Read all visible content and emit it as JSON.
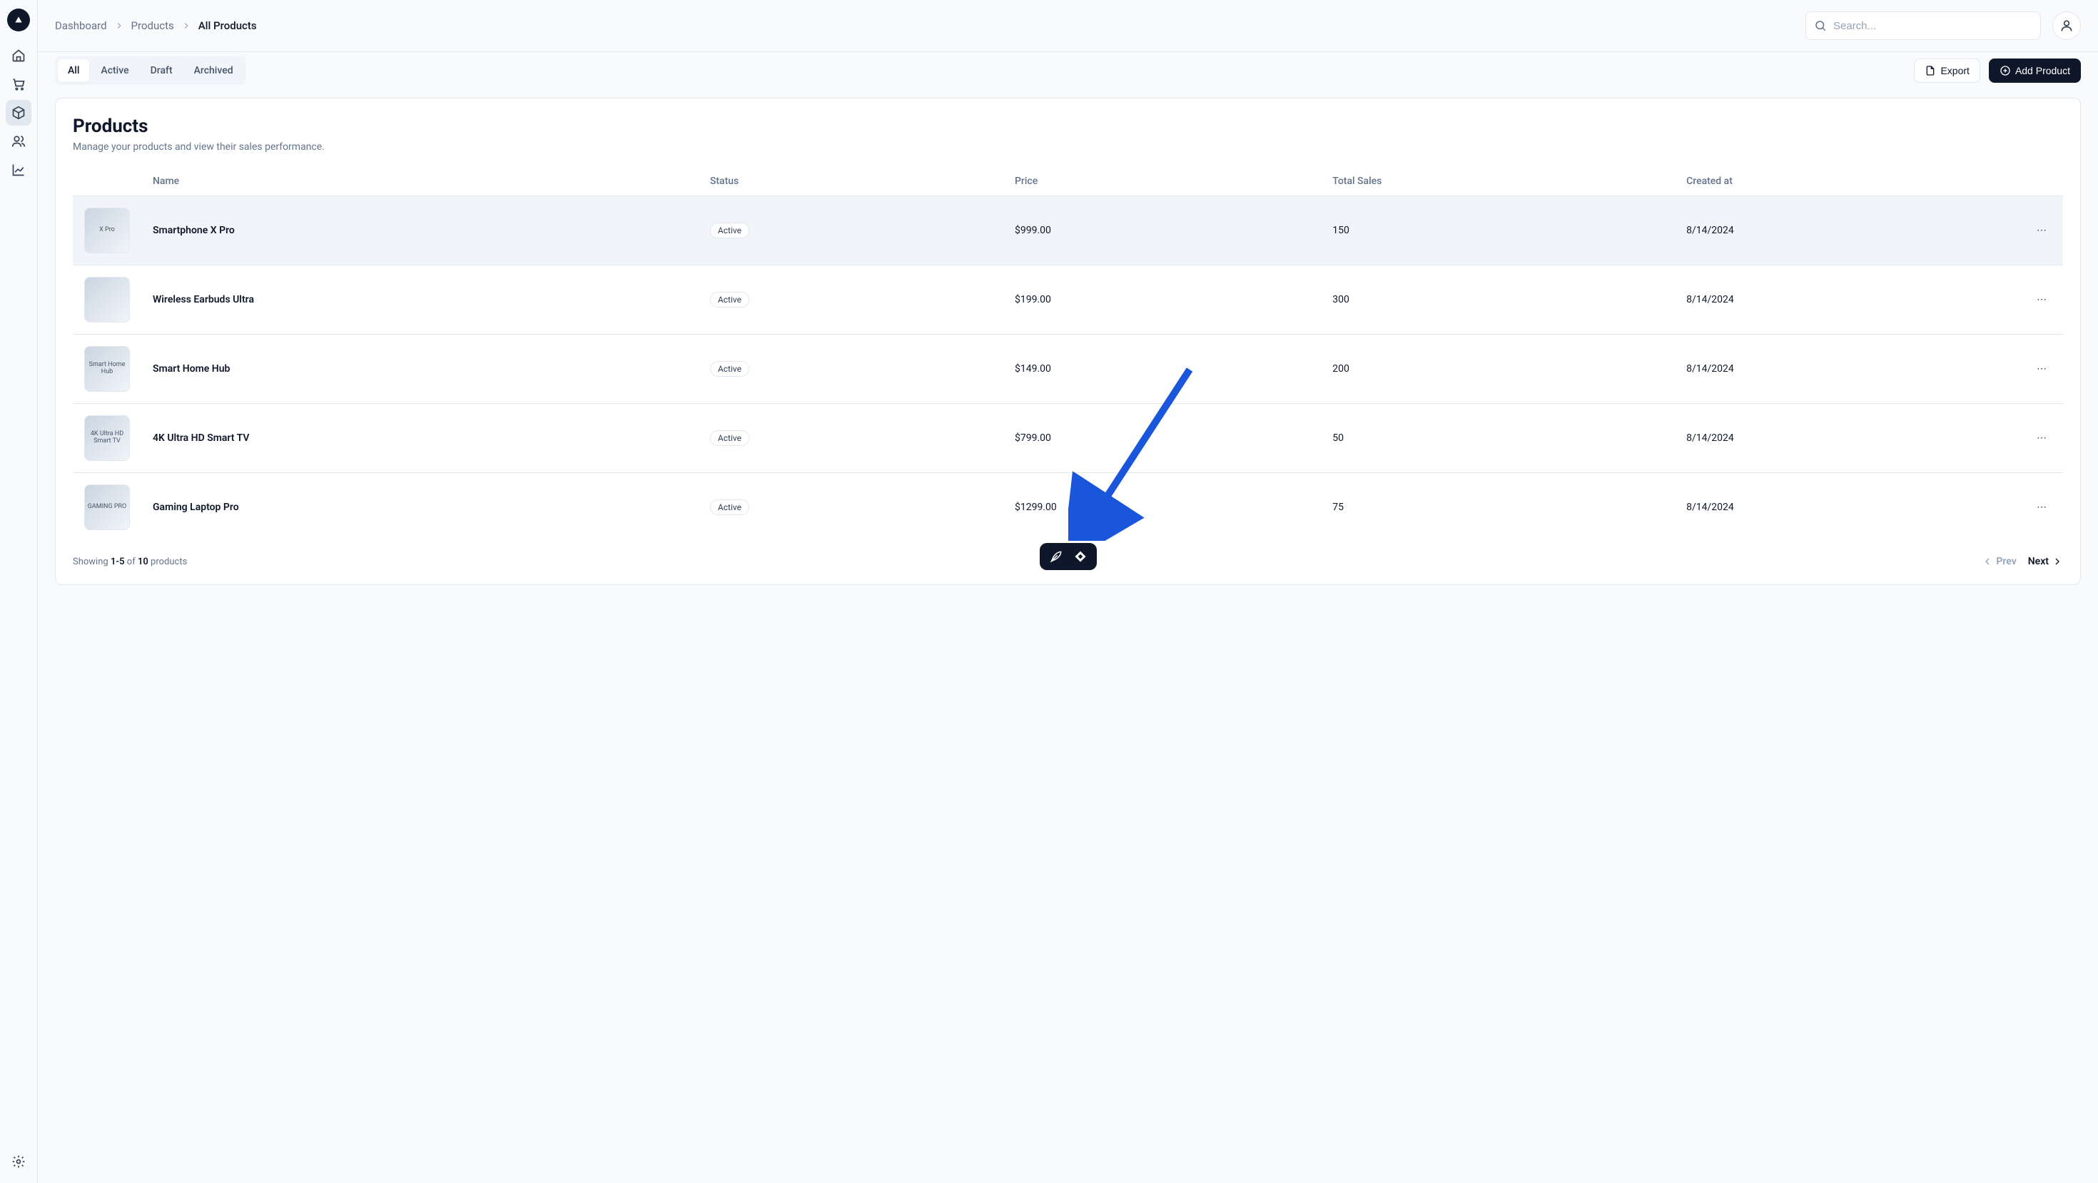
{
  "sidebar": {
    "items": [
      {
        "name": "home-icon"
      },
      {
        "name": "cart-icon"
      },
      {
        "name": "package-icon"
      },
      {
        "name": "users-icon"
      },
      {
        "name": "chart-icon"
      }
    ],
    "bottom": {
      "name": "settings-icon"
    }
  },
  "breadcrumb": [
    {
      "label": "Dashboard"
    },
    {
      "label": "Products"
    },
    {
      "label": "All Products"
    }
  ],
  "search": {
    "placeholder": "Search..."
  },
  "tabs": [
    {
      "label": "All",
      "active": true
    },
    {
      "label": "Active"
    },
    {
      "label": "Draft"
    },
    {
      "label": "Archived"
    }
  ],
  "actions": {
    "export_label": "Export",
    "add_label": "Add Product"
  },
  "page": {
    "title": "Products",
    "subtitle": "Manage your products and view their sales performance."
  },
  "table": {
    "columns": [
      "Name",
      "Status",
      "Price",
      "Total Sales",
      "Created at"
    ],
    "rows": [
      {
        "thumb_label": "X Pro",
        "name": "Smartphone X Pro",
        "status": "Active",
        "price": "$999.00",
        "sales": "150",
        "created": "8/14/2024",
        "selected": true
      },
      {
        "thumb_label": "",
        "name": "Wireless Earbuds Ultra",
        "status": "Active",
        "price": "$199.00",
        "sales": "300",
        "created": "8/14/2024"
      },
      {
        "thumb_label": "Smart Home Hub",
        "name": "Smart Home Hub",
        "status": "Active",
        "price": "$149.00",
        "sales": "200",
        "created": "8/14/2024"
      },
      {
        "thumb_label": "4K Ultra HD Smart TV",
        "name": "4K Ultra HD Smart TV",
        "status": "Active",
        "price": "$799.00",
        "sales": "50",
        "created": "8/14/2024"
      },
      {
        "thumb_label": "GAMING PRO",
        "name": "Gaming Laptop Pro",
        "status": "Active",
        "price": "$1299.00",
        "sales": "75",
        "created": "8/14/2024"
      }
    ]
  },
  "footer": {
    "showing_prefix": "Showing ",
    "range": "1-5",
    "of": " of ",
    "total": "10",
    "suffix": " products",
    "prev": "Prev",
    "next": "Next"
  },
  "arrow": {
    "color": "#1a56db"
  }
}
